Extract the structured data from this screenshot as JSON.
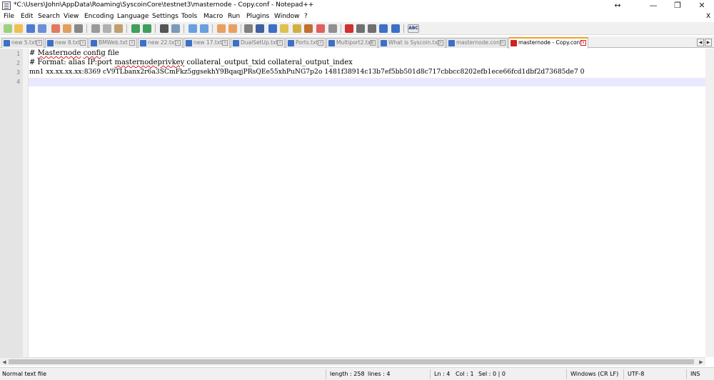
{
  "titlebar": {
    "title": "*C:\\Users\\John\\AppData\\Roaming\\SyscoinCore\\testnet3\\masternode - Copy.conf - Notepad++",
    "restore_size_glyph": "↔",
    "minimize_glyph": "—",
    "maximize_glyph": "❐",
    "close_glyph": "✕"
  },
  "menu": {
    "items": [
      "File",
      "Edit",
      "Search",
      "View",
      "Encoding",
      "Language",
      "Settings",
      "Tools",
      "Macro",
      "Run",
      "Plugins",
      "Window",
      "?"
    ],
    "close_glyph": "X"
  },
  "toolbar": {
    "icons": [
      "new-file-icon",
      "open-file-icon",
      "save-icon",
      "save-all-icon",
      "close-icon",
      "close-all-icon",
      "print-icon",
      "cut-icon",
      "copy-icon",
      "paste-icon",
      "undo-icon",
      "redo-icon",
      "find-icon",
      "replace-icon",
      "zoom-in-icon",
      "zoom-out-icon",
      "sync-vertical-icon",
      "sync-horizontal-icon",
      "word-wrap-icon",
      "show-all-chars-icon",
      "indent-guide-icon",
      "doc-map-icon",
      "function-list-icon",
      "folder-workspace-icon",
      "monitoring-icon",
      "record-macro-icon",
      "stop-macro-icon",
      "play-macro-icon",
      "run-macro-multiple-icon",
      "save-macro-icon",
      "spell-check-icon"
    ],
    "spellcheck_label": "ABC"
  },
  "tabs": [
    {
      "label": "new 5.txt",
      "active": false
    },
    {
      "label": "new 8.txt",
      "active": false
    },
    {
      "label": "BMWeb.txt",
      "active": false
    },
    {
      "label": "new 22.txt",
      "active": false
    },
    {
      "label": "new 17.txt",
      "active": false
    },
    {
      "label": "DualSetUp.txt",
      "active": false
    },
    {
      "label": "Ports.txt",
      "active": false
    },
    {
      "label": "Multiport2.txt",
      "active": false
    },
    {
      "label": "What is Syscoin.txt",
      "active": false
    },
    {
      "label": "masternode.conf",
      "active": false
    },
    {
      "label": "masternode - Copy.conf",
      "active": true
    }
  ],
  "tab_scroll": {
    "left": "◀",
    "right": "▶"
  },
  "editor": {
    "line_numbers": [
      "1",
      "2",
      "3",
      "4"
    ],
    "lines": [
      {
        "prefix": "# ",
        "squiggle": "Masternode",
        "mid": " ",
        "squiggle2": "config",
        "rest": " file"
      },
      {
        "prefix": "# Format: alias IP:port ",
        "squiggle": "masternodeprivkey",
        "mid": "",
        "squiggle2": "",
        "rest": " collateral_output_txid collateral_output_index"
      },
      {
        "prefix": "mn1 xx.xx.xx.xx:8369 cV9TLbanx2r6a3SCmFkz5ggsekhY9BqaqjPRsQEe55xhPuNG7p2o 1481f38914c13b7ef5bb501d8c717cbbcc8202efb1ece66fcd1dbf2d73685de7 0",
        "squiggle": "",
        "mid": "",
        "squiggle2": "",
        "rest": ""
      },
      {
        "prefix": "",
        "squiggle": "",
        "mid": "",
        "squiggle2": "",
        "rest": ""
      }
    ]
  },
  "scroll": {
    "left": "◀",
    "right": "▶"
  },
  "status": {
    "doc_type": "Normal text file",
    "length": "length : 258",
    "lines": "lines : 4",
    "ln": "Ln : 4",
    "col": "Col : 1",
    "sel": "Sel : 0 | 0",
    "eol": "Windows (CR LF)",
    "encoding": "UTF-8",
    "mode": "INS"
  },
  "colors": {
    "active_tab_accent": "#f5a623",
    "current_line": "#e8e8ff",
    "gutter": "#e4e4e4"
  }
}
